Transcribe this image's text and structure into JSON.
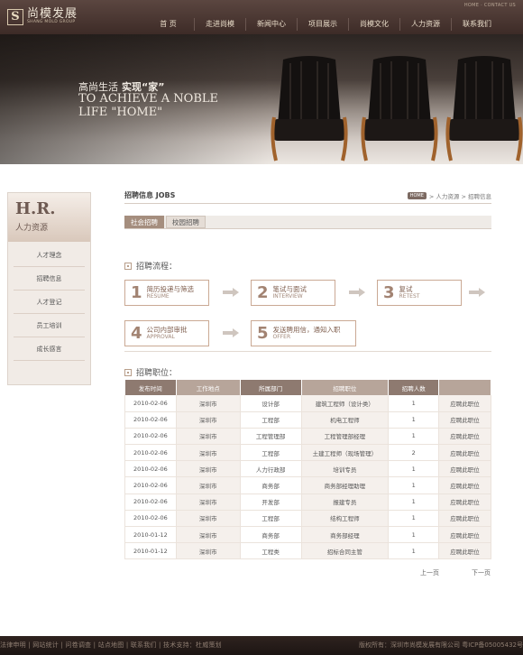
{
  "header": {
    "logo_mark": "S",
    "logo_title": "尚模发展",
    "logo_sub": "SHANG MOLD GROUP",
    "top_links": "HOME · CONTACT US",
    "nav": [
      "首 页",
      "走进尚模",
      "新闻中心",
      "项目展示",
      "尚模文化",
      "人力资源",
      "联系我们"
    ]
  },
  "banner": {
    "cn_plain": "高尚生活",
    "cn_bold": "实现“家”",
    "en_line1": "TO ACHIEVE A NOBLE",
    "en_line2": "LIFE \"HOME\""
  },
  "sidebar": {
    "hr_big": "H.R.",
    "hr_sub": "人力资源",
    "items": [
      "人才理念",
      "招聘信息",
      "人才登记",
      "员工培训",
      "成长感言"
    ]
  },
  "content": {
    "title": "招聘信息  JOBS",
    "breadcrumb": {
      "home": "HOME",
      "path": "> 人力资源 > 招聘信息"
    },
    "tabs": [
      "社会招聘",
      "校园招聘"
    ],
    "process_title": "招聘流程：",
    "steps": [
      {
        "num": "1",
        "cn": "简历投递与筛选",
        "en": "RESUME"
      },
      {
        "num": "2",
        "cn": "笔试与面试",
        "en": "INTERVIEW"
      },
      {
        "num": "3",
        "cn": "复试",
        "en": "RETEST"
      },
      {
        "num": "4",
        "cn": "公司内部审批",
        "en": "APPROVAL"
      },
      {
        "num": "5",
        "cn": "发送聘用信，通知入职",
        "en": "OFFER"
      }
    ],
    "positions_title": "招聘职位：",
    "table": {
      "headers": [
        "发布时间",
        "工作地点",
        "所属部门",
        "招聘职位",
        "招聘人数",
        ""
      ],
      "rows": [
        [
          "2010-02-06",
          "深圳市",
          "设计部",
          "建筑工程师（设计类）",
          "1",
          "应聘此职位"
        ],
        [
          "2010-02-06",
          "深圳市",
          "工程部",
          "机电工程师",
          "1",
          "应聘此职位"
        ],
        [
          "2010-02-06",
          "深圳市",
          "工程管理部",
          "工程管理部经理",
          "1",
          "应聘此职位"
        ],
        [
          "2010-02-06",
          "深圳市",
          "工程部",
          "土建工程师（现场管理）",
          "2",
          "应聘此职位"
        ],
        [
          "2010-02-06",
          "深圳市",
          "人力行政部",
          "培训专员",
          "1",
          "应聘此职位"
        ],
        [
          "2010-02-06",
          "深圳市",
          "商务部",
          "商务部经理助理",
          "1",
          "应聘此职位"
        ],
        [
          "2010-02-06",
          "深圳市",
          "开发部",
          "报建专员",
          "1",
          "应聘此职位"
        ],
        [
          "2010-02-06",
          "深圳市",
          "工程部",
          "结构工程师",
          "1",
          "应聘此职位"
        ],
        [
          "2010-01-12",
          "深圳市",
          "商务部",
          "商务部经理",
          "1",
          "应聘此职位"
        ],
        [
          "2010-01-12",
          "深圳市",
          "工程类",
          "招标合同主管",
          "1",
          "应聘此职位"
        ]
      ]
    },
    "pager": {
      "prev": "上一页",
      "next": "下一页"
    }
  },
  "footer": {
    "links": "法律申明 | 网站统计 | 问卷调查 | 站点地图 | 联系我们 | 技术支持：杜威策划",
    "copyright": "版权所有：深圳市尚模发展有限公司  粤ICP备05005432号"
  },
  "colors": {
    "brand_dark": "#3d2b27",
    "accent": "#a58e7e",
    "table_head": "#8e7a70"
  }
}
